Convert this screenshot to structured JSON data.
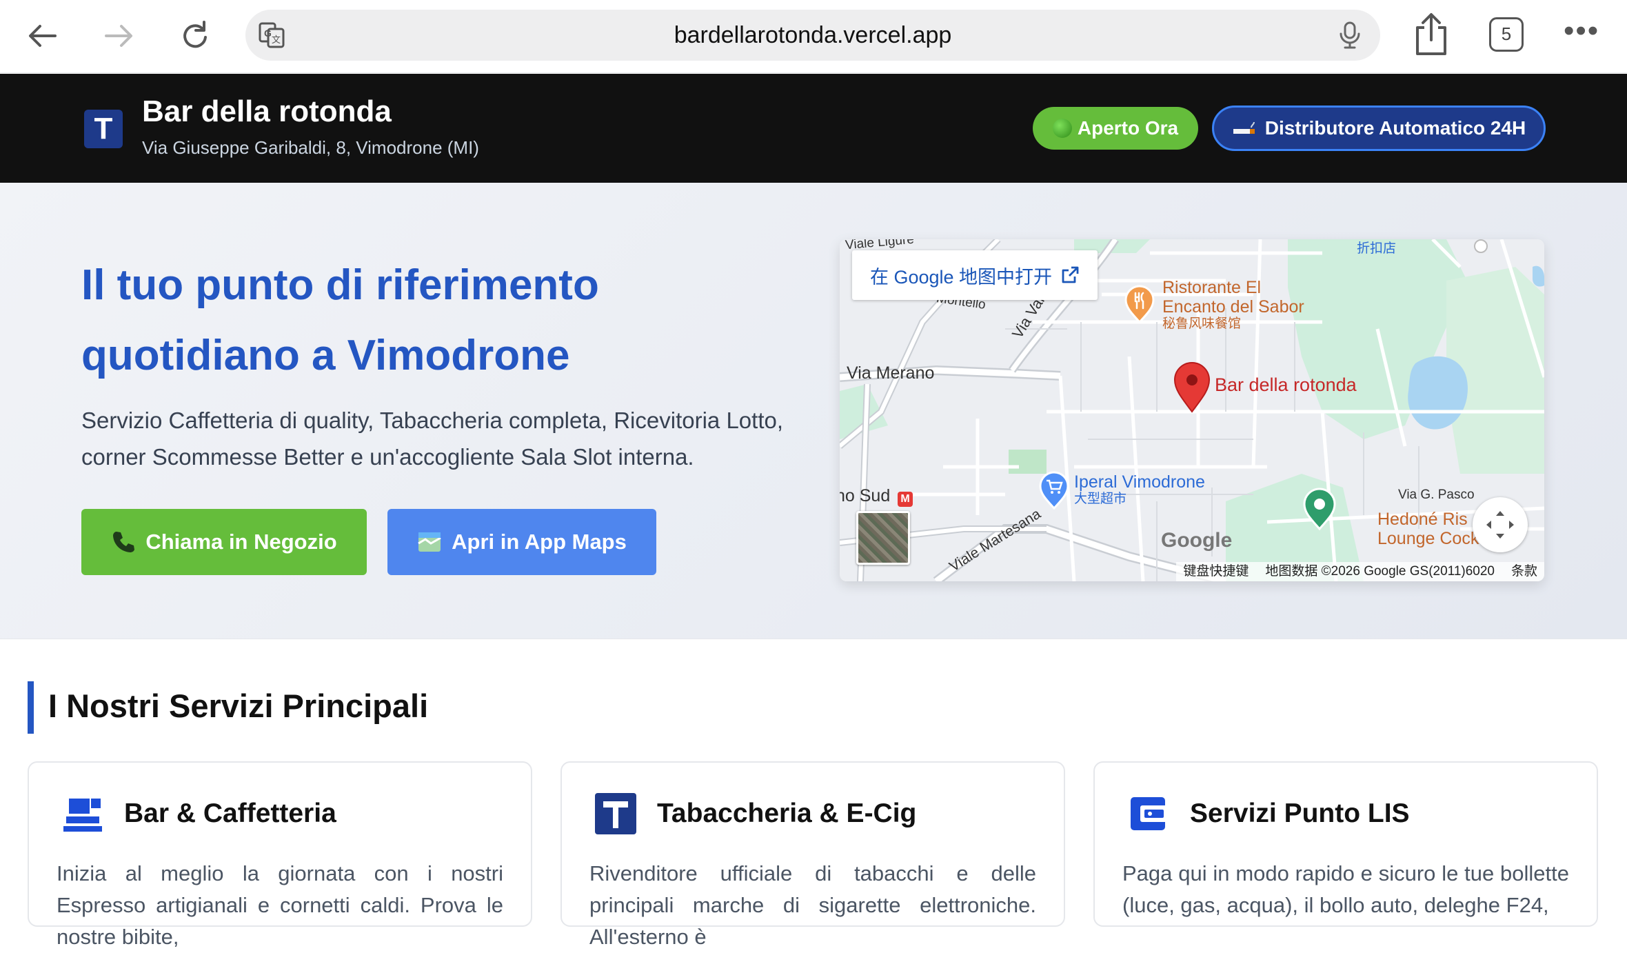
{
  "browser": {
    "url": "bardellarotonda.vercel.app",
    "tab_count": "5",
    "more": "•••"
  },
  "header": {
    "logo": "T",
    "title": "Bar della rotonda",
    "address": "Via Giuseppe Garibaldi, 8, Vimodrone (MI)",
    "open_badge": "Aperto Ora",
    "vending_badge": "Distributore Automatico 24H"
  },
  "hero": {
    "title_line1": "Il tuo punto di riferimento",
    "title_line2": "quotidiano a Vimodrone",
    "description": "Servizio Caffetteria di quality, Tabaccheria completa, Ricevitoria Lotto, corner Scommesse Better e un'accogliente Sala Slot interna.",
    "call_button": "Chiama in Negozio",
    "maps_button": "Apri in App Maps"
  },
  "map": {
    "open_in_google": "在 Google 地图中打开",
    "place_name": "Bar della rotonda",
    "restaurant_line1": "Ristorante El",
    "restaurant_line2": "Encanto del Sabor",
    "restaurant_sub": "秘鲁风味餐馆",
    "supermarket": "Iperal Vimodrone",
    "supermarket_sub": "大型超市",
    "road_merano": "Via Merano",
    "road_val": "Via Val",
    "road_martesana": "Viale Martesana",
    "road_pasco": "Via G. Pasco",
    "station_partial": "no Sud",
    "montello_partial": "Montello",
    "ligure_partial": "Viale Ligure",
    "discount": "折扣店",
    "hedone_line1": "Hedoné Ris",
    "hedone_line2": "Lounge Cock",
    "google_logo": "Google",
    "keyboard_shortcuts": "键盘快捷键",
    "map_data": "地图数据 ©2026 Google GS(2011)6020",
    "terms": "条款"
  },
  "services": {
    "title": "I Nostri Servizi Principali",
    "cards": [
      {
        "icon": "cash-register-icon",
        "title": "Bar & Caffetteria",
        "desc": "Inizia al meglio la giornata con i nostri Espresso artigianali e cornetti caldi. Prova le nostre bibite,"
      },
      {
        "icon": "tabacchi-t-icon",
        "title": "Tabaccheria & E-Cig",
        "desc": "Rivenditore ufficiale di tabacchi e delle principali marche di sigarette elettroniche. All'esterno è"
      },
      {
        "icon": "wallet-icon",
        "title": "Servizi Punto LIS",
        "desc": "Paga qui in modo rapido e sicuro le tue bollette (luce, gas, acqua), il bollo auto, deleghe F24,"
      }
    ]
  },
  "colors": {
    "brand_blue": "#2456c2",
    "green": "#65bd3b",
    "header_bg": "#111111",
    "navy": "#1e3a8a"
  }
}
